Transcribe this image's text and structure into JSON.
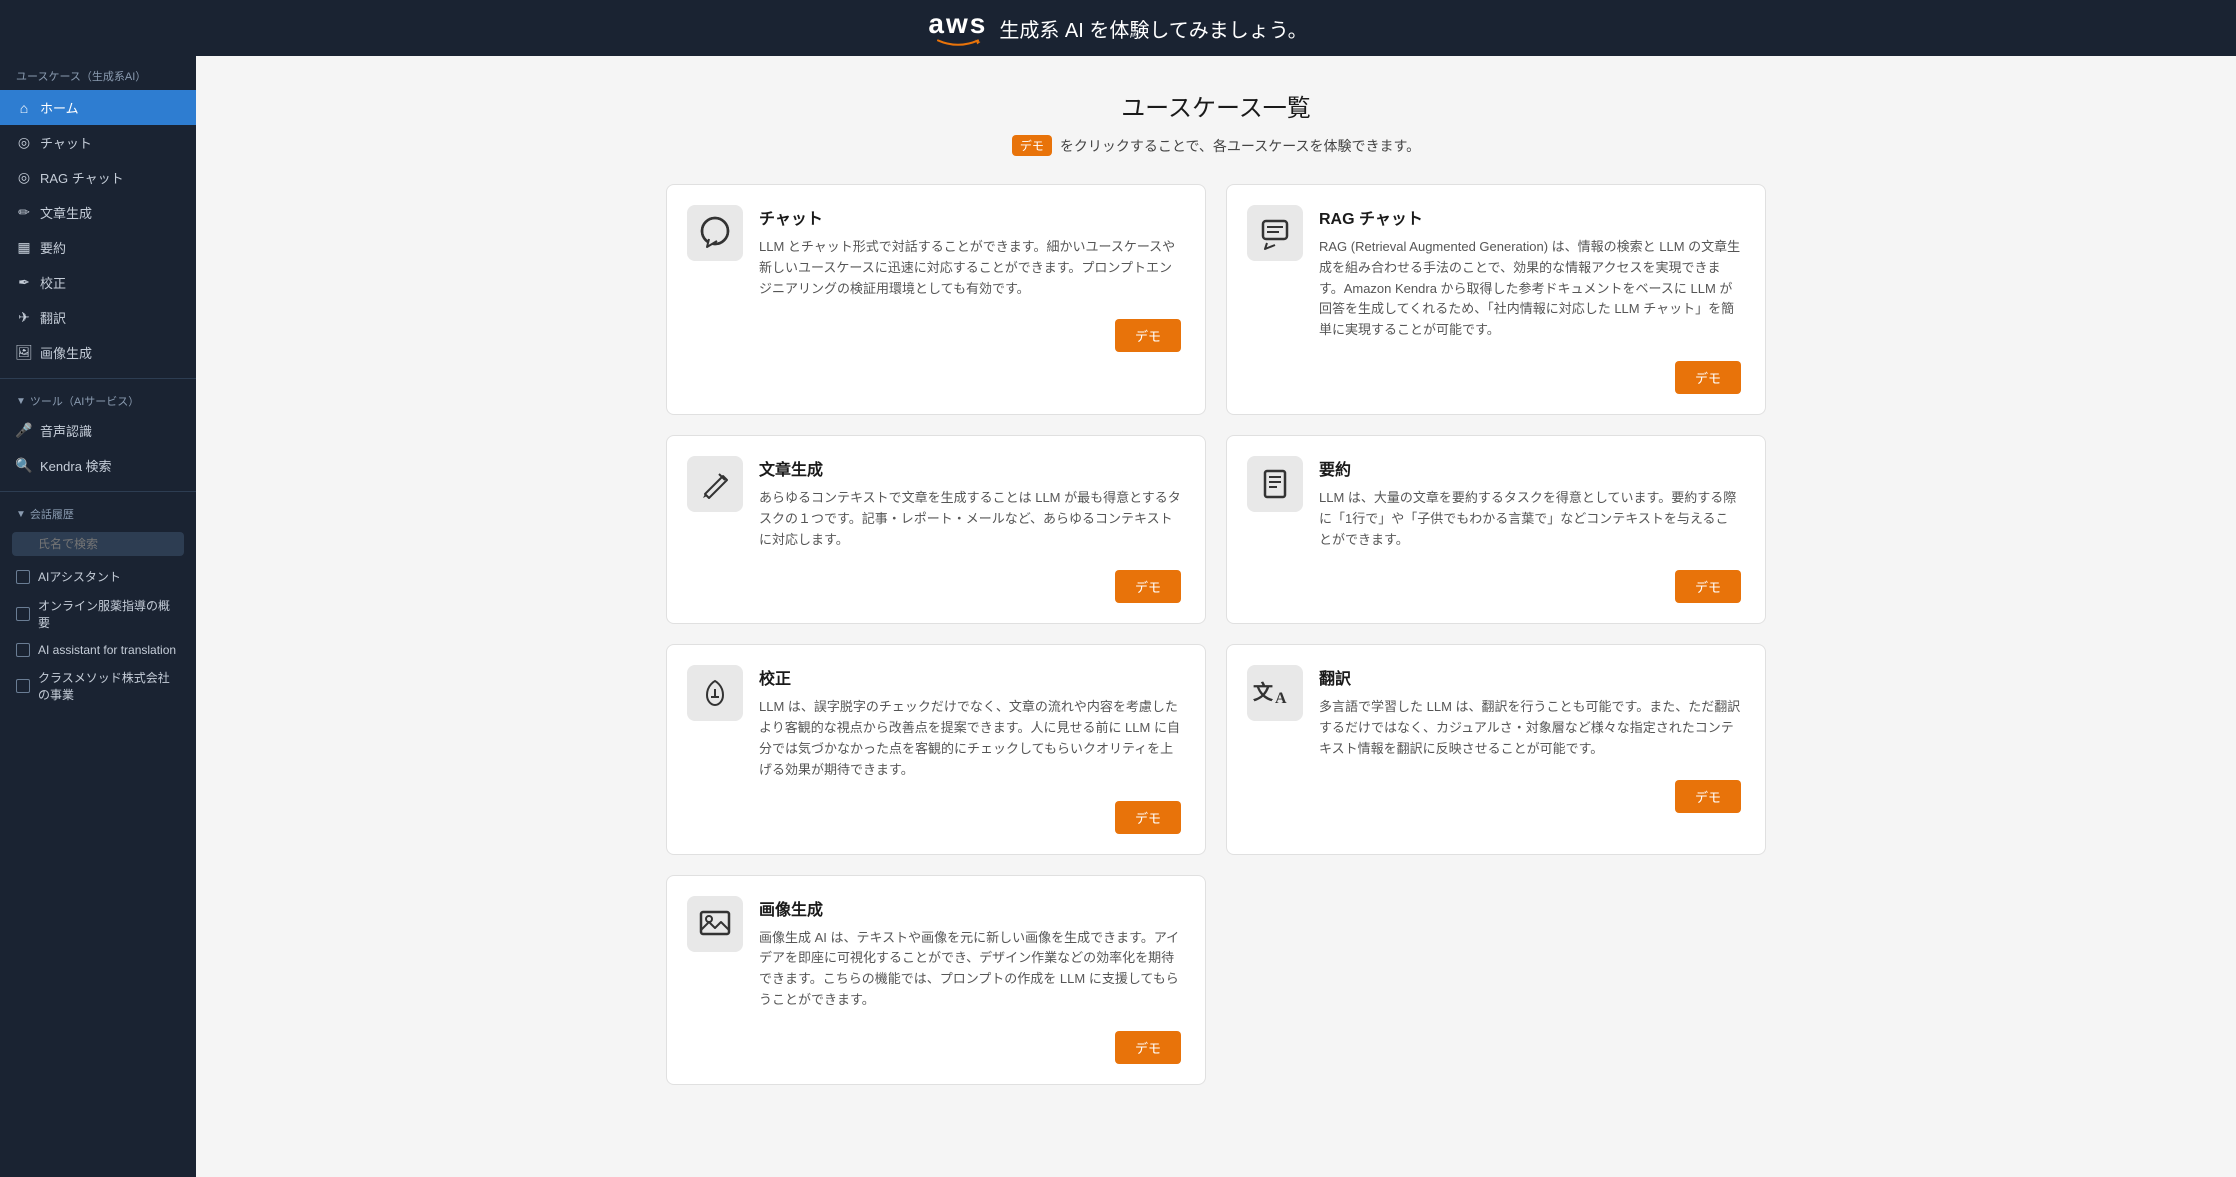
{
  "header": {
    "aws_text": "aws",
    "title": "生成系 AI を体験してみましょう。"
  },
  "sidebar": {
    "section_title": "ユースケース（生成系AI）",
    "nav_items": [
      {
        "id": "home",
        "label": "ホーム",
        "icon": "🏠",
        "active": true
      },
      {
        "id": "chat",
        "label": "チャット",
        "icon": "◎"
      },
      {
        "id": "rag-chat",
        "label": "RAG チャット",
        "icon": "◎"
      },
      {
        "id": "text-gen",
        "label": "文章生成",
        "icon": "✏️"
      },
      {
        "id": "summary",
        "label": "要約",
        "icon": "▦"
      },
      {
        "id": "proofread",
        "label": "校正",
        "icon": "✏️"
      },
      {
        "id": "translate",
        "label": "翻訳",
        "icon": "✈"
      },
      {
        "id": "image-gen",
        "label": "画像生成",
        "icon": "🖼"
      }
    ],
    "tools_section": "ツール（AIサービス）",
    "tool_items": [
      {
        "id": "speech",
        "label": "音声認識",
        "icon": "🎤"
      },
      {
        "id": "kendra",
        "label": "Kendra 検索",
        "icon": "🔍"
      }
    ],
    "history_section": "会話履歴",
    "search_placeholder": "氏名で検索",
    "history_items": [
      {
        "id": "h1",
        "label": "AIアシスタント"
      },
      {
        "id": "h2",
        "label": "オンライン服薬指導の概要"
      },
      {
        "id": "h3",
        "label": "AI assistant for translation"
      },
      {
        "id": "h4",
        "label": "クラスメソッド株式会社の事業"
      }
    ]
  },
  "main": {
    "page_title": "ユースケース一覧",
    "subtitle_prefix": "デモ",
    "subtitle_suffix": "をクリックすることで、各ユースケースを体験できます。",
    "cards": [
      {
        "id": "chat",
        "title": "チャット",
        "icon": "💬",
        "description": "LLM とチャット形式で対話することができます。細かいユースケースや新しいユースケースに迅速に対応することができます。プロンプトエンジニアリングの検証用環境としても有効です。",
        "demo_label": "デモ"
      },
      {
        "id": "rag-chat",
        "title": "RAG チャット",
        "icon": "💬",
        "description": "RAG (Retrieval Augmented Generation) は、情報の検索と LLM の文章生成を組み合わせる手法のことで、効果的な情報アクセスを実現できます。Amazon Kendra から取得した参考ドキュメントをベースに LLM が回答を生成してくれるため、「社内情報に対応した LLM チャット」を簡単に実現することが可能です。",
        "demo_label": "デモ"
      },
      {
        "id": "text-gen",
        "title": "文章生成",
        "icon": "✏️",
        "description": "あらゆるコンテキストで文章を生成することは LLM が最も得意とするタスクの１つです。記事・レポート・メールなど、あらゆるコンテキストに対応します。",
        "demo_label": "デモ"
      },
      {
        "id": "summary",
        "title": "要約",
        "icon": "📋",
        "description": "LLM は、大量の文章を要約するタスクを得意としています。要約する際に「1行で」や「子供でもわかる言葉で」などコンテキストを与えることができます。",
        "demo_label": "デモ"
      },
      {
        "id": "proofread",
        "title": "校正",
        "icon": "🖊️",
        "description": "LLM は、誤字脱字のチェックだけでなく、文章の流れや内容を考慮したより客観的な視点から改善点を提案できます。人に見せる前に LLM に自分では気づかなかった点を客観的にチェックしてもらいクオリティを上げる効果が期待できます。",
        "demo_label": "デモ"
      },
      {
        "id": "translate",
        "title": "翻訳",
        "icon": "文A",
        "description": "多言語で学習した LLM は、翻訳を行うことも可能です。また、ただ翻訳するだけではなく、カジュアルさ・対象層など様々な指定されたコンテキスト情報を翻訳に反映させることが可能です。",
        "demo_label": "デモ"
      },
      {
        "id": "image-gen",
        "title": "画像生成",
        "icon": "🖼️",
        "description": "画像生成 AI は、テキストや画像を元に新しい画像を生成できます。アイデアを即座に可視化することができ、デザイン作業などの効率化を期待できます。こちらの機能では、プロンプトの作成を LLM に支援してもらうことができます。",
        "demo_label": "デモ"
      }
    ]
  },
  "icons": {
    "home": "⌂",
    "chat": "chat-bubble",
    "search": "🔍",
    "speech": "microphone",
    "history": "history"
  }
}
